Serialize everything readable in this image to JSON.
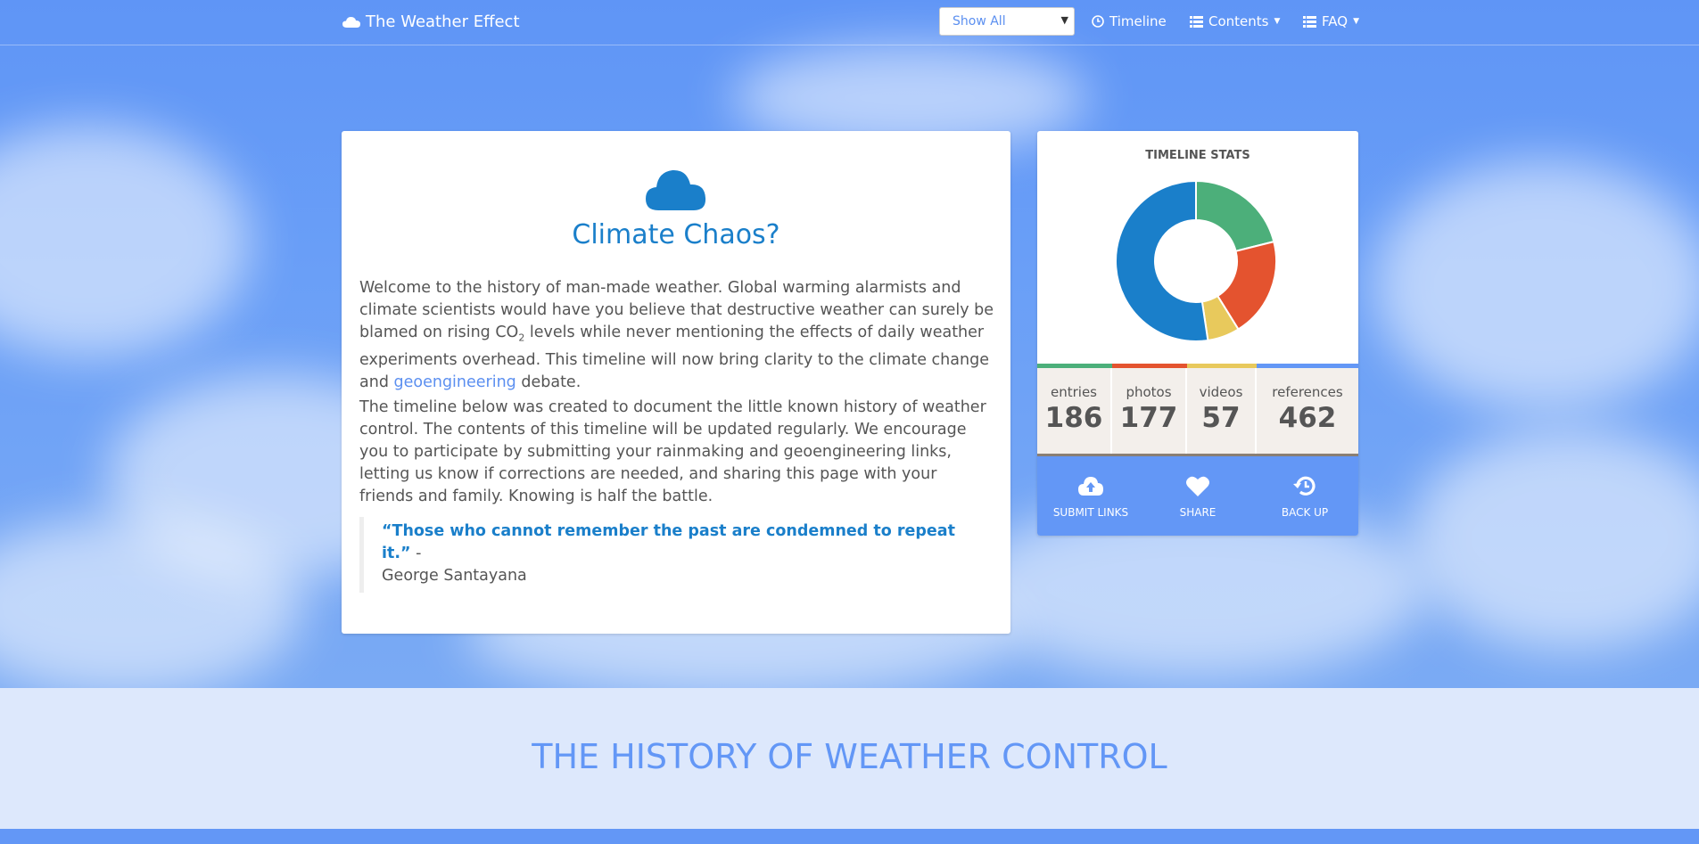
{
  "nav": {
    "brand": "The Weather Effect",
    "filter_select": "Show All",
    "timeline": "Timeline",
    "contents": "Contents",
    "faq": "FAQ"
  },
  "intro": {
    "title": "Climate Chaos?",
    "p1_before": "Welcome to the history of man-made weather. Global warming alarmists and climate scientists would have you believe that destructive weather can surely be blamed on rising CO",
    "p1_sub": "2",
    "p1_middle": " levels while never mentioning the effects of daily weather experiments overhead. This timeline will now bring clarity to the climate change and ",
    "p1_link": "geoengineering",
    "p1_after": " debate.",
    "p2": "The timeline below was created to document the little known history of weather control. The contents of this timeline will be updated regularly. We encourage you to participate by submitting your rainmaking and geoengineering links, letting us know if corrections are needed, and sharing this page with your friends and family. Knowing is half the battle.",
    "quote": "“Those who cannot remember the past are condemned to repeat it.”",
    "quote_dash": " -",
    "quote_author": "George Santayana"
  },
  "stats": {
    "title": "TIMELINE STATS",
    "items": [
      {
        "label": "entries",
        "value": "186"
      },
      {
        "label": "photos",
        "value": "177"
      },
      {
        "label": "videos",
        "value": "57"
      },
      {
        "label": "references",
        "value": "462"
      }
    ],
    "actions": [
      {
        "label": "SUBMIT LINKS",
        "icon": "cloud-upload-icon"
      },
      {
        "label": "SHARE",
        "icon": "heart-icon"
      },
      {
        "label": "BACK UP",
        "icon": "history-icon"
      }
    ],
    "colors": {
      "green": "#4caf7a",
      "red": "#e4532f",
      "yellow": "#e8c95c",
      "blue": "#1a7fca",
      "accent": "#6397f6"
    }
  },
  "chart_data": {
    "type": "pie",
    "title": "TIMELINE STATS",
    "categories": [
      "entries",
      "photos",
      "videos",
      "references"
    ],
    "values": [
      186,
      177,
      57,
      462
    ]
  },
  "history": {
    "title": "THE HISTORY OF WEATHER CONTROL"
  }
}
